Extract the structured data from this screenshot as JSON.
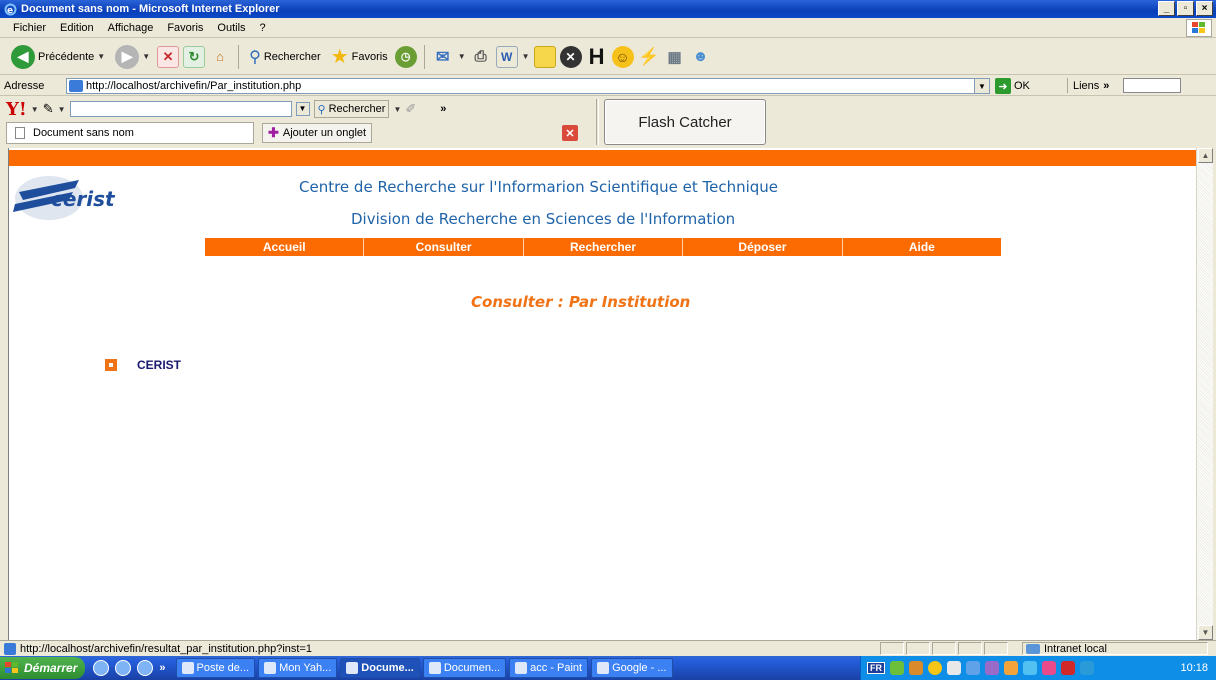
{
  "window": {
    "title": "Document sans nom - Microsoft Internet Explorer",
    "minimize": "_",
    "maximize": "▫",
    "close": "×"
  },
  "menu": [
    "Fichier",
    "Edition",
    "Affichage",
    "Favoris",
    "Outils",
    "?"
  ],
  "toolbar": {
    "back_label": "Précédente",
    "search_label": "Rechercher",
    "favorites_label": "Favoris"
  },
  "address": {
    "label": "Adresse",
    "url": "http://localhost/archivefin/Par_institution.php",
    "go_label": "OK",
    "links_label": "Liens"
  },
  "yahoo": {
    "search_label": "Rechercher",
    "search_value": ""
  },
  "tabs": {
    "active_tab": "Document sans nom",
    "add_tab": "Ajouter un onglet",
    "overflow": "»"
  },
  "flash_catcher": "Flash Catcher",
  "page": {
    "heading1": "Centre de Recherche sur l'Informarion Scientifique et Technique",
    "heading2": "Division de Recherche en Sciences de l'Information",
    "logo_text": "cerist",
    "nav": [
      "Accueil",
      "Consulter",
      "Rechercher",
      "Déposer",
      "Aide"
    ],
    "title": "Consulter : Par Institution",
    "institutions": [
      "CERIST"
    ]
  },
  "status": {
    "text": "http://localhost/archivefin/resultat_par_institution.php?inst=1",
    "zone": "Intranet local"
  },
  "taskbar": {
    "start": "Démarrer",
    "quicklaunch_more": "»",
    "tasks": [
      {
        "label": "Poste de...",
        "active": false
      },
      {
        "label": "Mon Yah...",
        "active": false
      },
      {
        "label": "Docume...",
        "active": true
      },
      {
        "label": "Documen...",
        "active": false
      },
      {
        "label": "acc - Paint",
        "active": false
      },
      {
        "label": "Google - ...",
        "active": false
      }
    ],
    "lang": "FR",
    "clock": "10:18"
  },
  "colors": {
    "accent_orange": "#fb6b02",
    "heading_blue": "#1f63a8",
    "title_orange": "#f07416"
  }
}
